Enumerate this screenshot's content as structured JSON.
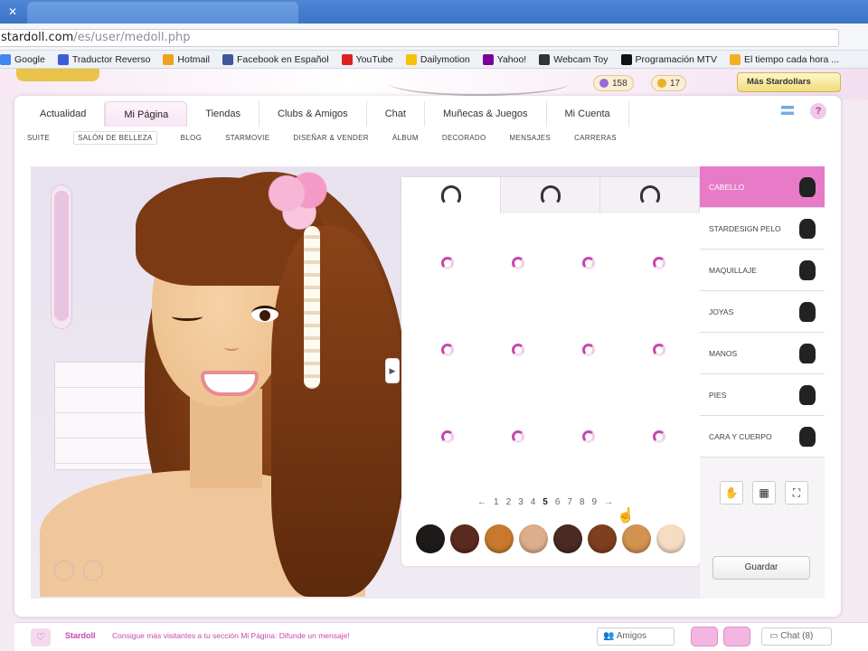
{
  "browser": {
    "url_prefix": "stardoll.com",
    "url_path": "/es/user/medoll.php"
  },
  "bookmarks": [
    {
      "label": "Google",
      "color": "#4285f4"
    },
    {
      "label": "Traductor Reverso",
      "color": "#3b5bdb"
    },
    {
      "label": "Hotmail",
      "color": "#f0a020"
    },
    {
      "label": "Facebook en Español",
      "color": "#3b5998"
    },
    {
      "label": "YouTube",
      "color": "#e02020"
    },
    {
      "label": "Dailymotion",
      "color": "#f5c400"
    },
    {
      "label": "Yahoo!",
      "color": "#7b0099"
    },
    {
      "label": "Webcam Toy",
      "color": "#333333"
    },
    {
      "label": "Programación MTV",
      "color": "#111111"
    },
    {
      "label": "El tiempo cada hora ...",
      "color": "#f0b020"
    }
  ],
  "header": {
    "stardollars": "158",
    "starcoins": "17",
    "more_label": "Más Stardollars"
  },
  "nav": {
    "tabs": [
      "Actualidad",
      "Mi Página",
      "Tiendas",
      "Clubs & Amigos",
      "Chat",
      "Muñecas & Juegos",
      "Mi Cuenta"
    ],
    "active": "Mi Página"
  },
  "subnav": {
    "items": [
      "Suite",
      "Salón de belleza",
      "Blog",
      "Starmovie",
      "Diseñar & Vender",
      "Álbum",
      "Decorado",
      "Mensajes",
      "Carreras"
    ],
    "active": "Salón de belleza"
  },
  "categories": [
    {
      "label": "Cabello",
      "active": true
    },
    {
      "label": "Stardesign pelo",
      "active": false
    },
    {
      "label": "Maquillaje",
      "active": false
    },
    {
      "label": "Joyas",
      "active": false
    },
    {
      "label": "Manos",
      "active": false
    },
    {
      "label": "Pies",
      "active": false
    },
    {
      "label": "Cara y cuerpo",
      "active": false
    }
  ],
  "pager": {
    "prev": "←",
    "pages": [
      "1",
      "2",
      "3",
      "4",
      "5",
      "6",
      "7",
      "8",
      "9"
    ],
    "current": "5",
    "next": "→"
  },
  "swatch_colors": [
    "#1f1a1a",
    "#5a2a1e",
    "#c9792e",
    "#dcae8c",
    "#4a2a22",
    "#7d3f1f",
    "#d1934e",
    "#f7dcc4"
  ],
  "save_label": "Guardar",
  "footer": {
    "brand": "Stardoll",
    "message": "Consigue más visitantes a tu sección Mi Página: Difunde un mensaje!",
    "friends_label": "Amigos",
    "chat_label": "Chat (8)"
  }
}
